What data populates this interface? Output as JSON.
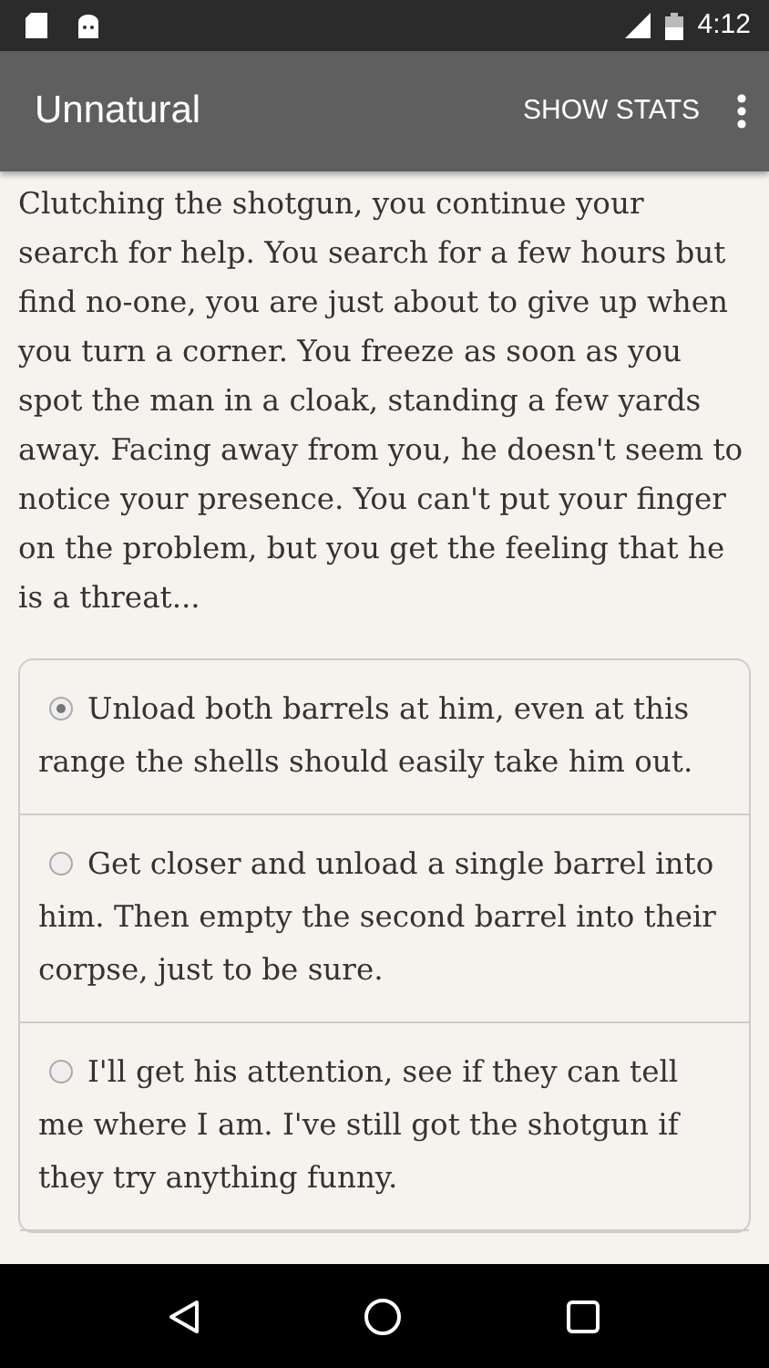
{
  "status_bar": {
    "time": "4:12"
  },
  "app_bar": {
    "title": "Unnatural",
    "action": "SHOW STATS"
  },
  "story": "Clutching the shotgun, you continue your search for help. You search for a few hours but find no-one, you are just about to give up when you turn a corner. You freeze as soon as you spot the man in a cloak, standing a few yards away. Facing away from you, he doesn't seem to notice your presence. You can't put your finger on the problem, but you get the feeling that he is a threat...",
  "choices": [
    {
      "label": "Unload both barrels at him, even at this range the shells should easily take him out.",
      "selected": true
    },
    {
      "label": "Get closer and unload a single barrel into him. Then empty the second barrel into their corpse, just to be sure.",
      "selected": false
    },
    {
      "label": "I'll get his attention, see if they can tell me where I am. I've still got the shotgun if they try anything funny.",
      "selected": false
    }
  ]
}
